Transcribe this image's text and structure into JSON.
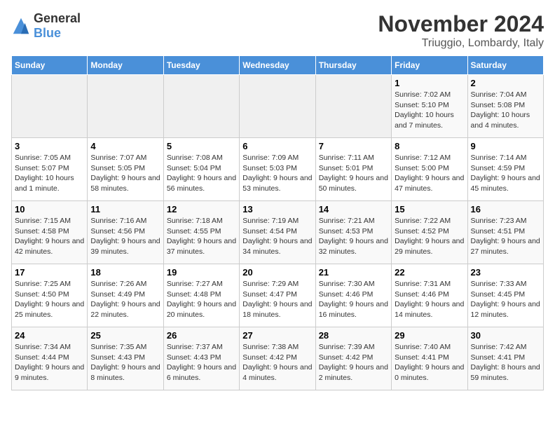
{
  "logo": {
    "general": "General",
    "blue": "Blue"
  },
  "header": {
    "month": "November 2024",
    "location": "Triuggio, Lombardy, Italy"
  },
  "weekdays": [
    "Sunday",
    "Monday",
    "Tuesday",
    "Wednesday",
    "Thursday",
    "Friday",
    "Saturday"
  ],
  "weeks": [
    [
      {
        "day": "",
        "info": ""
      },
      {
        "day": "",
        "info": ""
      },
      {
        "day": "",
        "info": ""
      },
      {
        "day": "",
        "info": ""
      },
      {
        "day": "",
        "info": ""
      },
      {
        "day": "1",
        "info": "Sunrise: 7:02 AM\nSunset: 5:10 PM\nDaylight: 10 hours and 7 minutes."
      },
      {
        "day": "2",
        "info": "Sunrise: 7:04 AM\nSunset: 5:08 PM\nDaylight: 10 hours and 4 minutes."
      }
    ],
    [
      {
        "day": "3",
        "info": "Sunrise: 7:05 AM\nSunset: 5:07 PM\nDaylight: 10 hours and 1 minute."
      },
      {
        "day": "4",
        "info": "Sunrise: 7:07 AM\nSunset: 5:05 PM\nDaylight: 9 hours and 58 minutes."
      },
      {
        "day": "5",
        "info": "Sunrise: 7:08 AM\nSunset: 5:04 PM\nDaylight: 9 hours and 56 minutes."
      },
      {
        "day": "6",
        "info": "Sunrise: 7:09 AM\nSunset: 5:03 PM\nDaylight: 9 hours and 53 minutes."
      },
      {
        "day": "7",
        "info": "Sunrise: 7:11 AM\nSunset: 5:01 PM\nDaylight: 9 hours and 50 minutes."
      },
      {
        "day": "8",
        "info": "Sunrise: 7:12 AM\nSunset: 5:00 PM\nDaylight: 9 hours and 47 minutes."
      },
      {
        "day": "9",
        "info": "Sunrise: 7:14 AM\nSunset: 4:59 PM\nDaylight: 9 hours and 45 minutes."
      }
    ],
    [
      {
        "day": "10",
        "info": "Sunrise: 7:15 AM\nSunset: 4:58 PM\nDaylight: 9 hours and 42 minutes."
      },
      {
        "day": "11",
        "info": "Sunrise: 7:16 AM\nSunset: 4:56 PM\nDaylight: 9 hours and 39 minutes."
      },
      {
        "day": "12",
        "info": "Sunrise: 7:18 AM\nSunset: 4:55 PM\nDaylight: 9 hours and 37 minutes."
      },
      {
        "day": "13",
        "info": "Sunrise: 7:19 AM\nSunset: 4:54 PM\nDaylight: 9 hours and 34 minutes."
      },
      {
        "day": "14",
        "info": "Sunrise: 7:21 AM\nSunset: 4:53 PM\nDaylight: 9 hours and 32 minutes."
      },
      {
        "day": "15",
        "info": "Sunrise: 7:22 AM\nSunset: 4:52 PM\nDaylight: 9 hours and 29 minutes."
      },
      {
        "day": "16",
        "info": "Sunrise: 7:23 AM\nSunset: 4:51 PM\nDaylight: 9 hours and 27 minutes."
      }
    ],
    [
      {
        "day": "17",
        "info": "Sunrise: 7:25 AM\nSunset: 4:50 PM\nDaylight: 9 hours and 25 minutes."
      },
      {
        "day": "18",
        "info": "Sunrise: 7:26 AM\nSunset: 4:49 PM\nDaylight: 9 hours and 22 minutes."
      },
      {
        "day": "19",
        "info": "Sunrise: 7:27 AM\nSunset: 4:48 PM\nDaylight: 9 hours and 20 minutes."
      },
      {
        "day": "20",
        "info": "Sunrise: 7:29 AM\nSunset: 4:47 PM\nDaylight: 9 hours and 18 minutes."
      },
      {
        "day": "21",
        "info": "Sunrise: 7:30 AM\nSunset: 4:46 PM\nDaylight: 9 hours and 16 minutes."
      },
      {
        "day": "22",
        "info": "Sunrise: 7:31 AM\nSunset: 4:46 PM\nDaylight: 9 hours and 14 minutes."
      },
      {
        "day": "23",
        "info": "Sunrise: 7:33 AM\nSunset: 4:45 PM\nDaylight: 9 hours and 12 minutes."
      }
    ],
    [
      {
        "day": "24",
        "info": "Sunrise: 7:34 AM\nSunset: 4:44 PM\nDaylight: 9 hours and 9 minutes."
      },
      {
        "day": "25",
        "info": "Sunrise: 7:35 AM\nSunset: 4:43 PM\nDaylight: 9 hours and 8 minutes."
      },
      {
        "day": "26",
        "info": "Sunrise: 7:37 AM\nSunset: 4:43 PM\nDaylight: 9 hours and 6 minutes."
      },
      {
        "day": "27",
        "info": "Sunrise: 7:38 AM\nSunset: 4:42 PM\nDaylight: 9 hours and 4 minutes."
      },
      {
        "day": "28",
        "info": "Sunrise: 7:39 AM\nSunset: 4:42 PM\nDaylight: 9 hours and 2 minutes."
      },
      {
        "day": "29",
        "info": "Sunrise: 7:40 AM\nSunset: 4:41 PM\nDaylight: 9 hours and 0 minutes."
      },
      {
        "day": "30",
        "info": "Sunrise: 7:42 AM\nSunset: 4:41 PM\nDaylight: 8 hours and 59 minutes."
      }
    ]
  ]
}
